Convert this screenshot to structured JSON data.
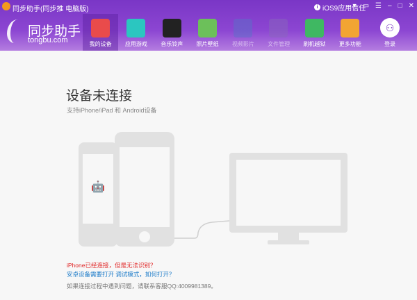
{
  "window": {
    "title": "同步助手(同步推 电脑版)",
    "ios_trust": "iOS9应用信任",
    "controls": [
      "▾",
      "▭",
      "☰",
      "–",
      "□",
      "✕"
    ]
  },
  "logo": {
    "name": "同步助手",
    "url": "tongbu.com"
  },
  "nav": [
    {
      "label": "我的设备",
      "icon": "store-icon",
      "color": "#e94b4b",
      "active": true
    },
    {
      "label": "应用游戏",
      "icon": "app-store-icon",
      "color": "#2bc6c0"
    },
    {
      "label": "音乐铃声",
      "icon": "vinyl-icon",
      "color": "#222222"
    },
    {
      "label": "照片壁纸",
      "icon": "picture-icon",
      "color": "#6cc05a"
    },
    {
      "label": "视频影片",
      "icon": "clapper-icon",
      "color": "#5a6fc8",
      "dim": true
    },
    {
      "label": "文件管理",
      "icon": "folder-icon",
      "color": "#8866bb",
      "dim": true
    },
    {
      "label": "刷机越狱",
      "icon": "refresh-icon",
      "color": "#3fb862"
    },
    {
      "label": "更多功能",
      "icon": "tiles-icon",
      "color": "#f2a533"
    }
  ],
  "login": {
    "label": "登录",
    "icon": "user-icon"
  },
  "main": {
    "title": "设备未连接",
    "subtitle": "支持iPhone/iPad 和 Android设备",
    "link_red": "iPhone已经连接，但是无法识别？",
    "link_blue": "安卓设备需要打开 调试模式，如何打开？",
    "help": "如果连接过程中遇到问题，请联系客服QQ:4009981389。"
  },
  "colors": {
    "accent": "#7a36c6",
    "red": "#e02424",
    "blue": "#1a7ac8"
  }
}
